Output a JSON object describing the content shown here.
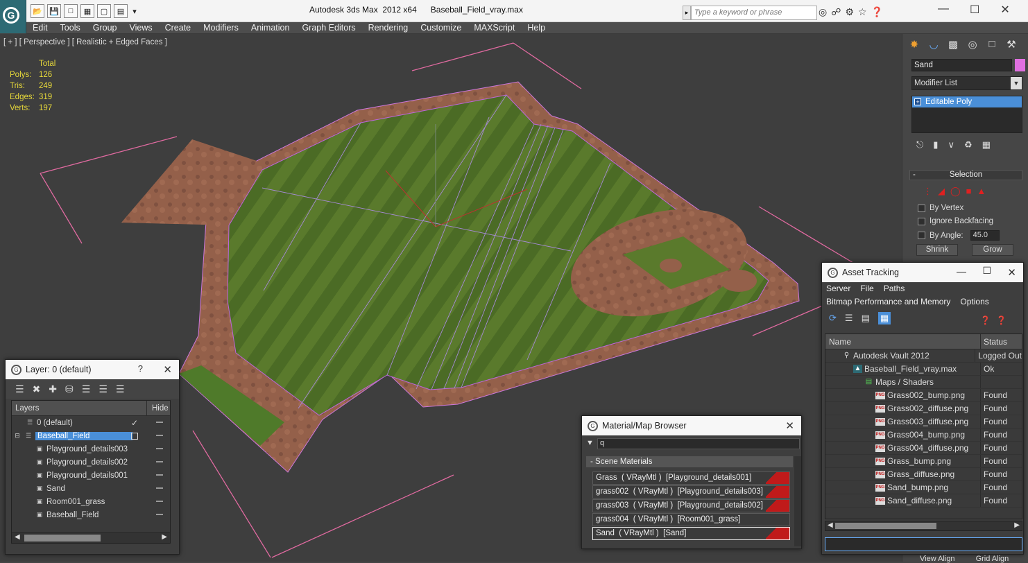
{
  "window": {
    "app_title": "Autodesk 3ds Max  2012 x64",
    "file_title": "Baseball_Field_vray.max",
    "search_placeholder": "Type a keyword or phrase"
  },
  "menu": [
    "Edit",
    "Tools",
    "Group",
    "Views",
    "Create",
    "Modifiers",
    "Animation",
    "Graph Editors",
    "Rendering",
    "Customize",
    "MAXScript",
    "Help"
  ],
  "viewport": {
    "label": "[ + ] [ Perspective ] [ Realistic + Edged Faces ]",
    "stats_header": "Total",
    "stats": [
      {
        "key": "Polys:",
        "value": "126"
      },
      {
        "key": "Tris:",
        "value": "249"
      },
      {
        "key": "Edges:",
        "value": "319"
      },
      {
        "key": "Verts:",
        "value": "197"
      }
    ]
  },
  "command_panel": {
    "object_name": "Sand",
    "object_color": "#e070e0",
    "modifier_list": "Modifier List",
    "stack_item": "Editable Poly",
    "selection_title": "Selection",
    "by_vertex": "By Vertex",
    "ignore_backfacing": "Ignore Backfacing",
    "by_angle": "By Angle:",
    "angle_value": "45.0",
    "shrink": "Shrink",
    "grow": "Grow"
  },
  "layer_panel": {
    "title": "Layer: 0 (default)",
    "help": "?",
    "col_layers": "Layers",
    "col_hide": "Hide",
    "rows": [
      {
        "name": "0 (default)",
        "type": "layer",
        "indent": 0
      },
      {
        "name": "Baseball_Field",
        "type": "layer",
        "indent": 0,
        "selected": true
      },
      {
        "name": "Playground_details003",
        "type": "object",
        "indent": 1
      },
      {
        "name": "Playground_details002",
        "type": "object",
        "indent": 1
      },
      {
        "name": "Playground_details001",
        "type": "object",
        "indent": 1
      },
      {
        "name": "Sand",
        "type": "object",
        "indent": 1
      },
      {
        "name": "Room001_grass",
        "type": "object",
        "indent": 1
      },
      {
        "name": "Baseball_Field",
        "type": "object",
        "indent": 1
      }
    ]
  },
  "material_browser": {
    "title": "Material/Map Browser",
    "search_value": "q",
    "section": "- Scene Materials",
    "rows": [
      "Grass  ( VRayMtl )  [Playground_details001]",
      "grass002  ( VRayMtl )  [Playground_details003]",
      "grass003  ( VRayMtl )  [Playground_details002]",
      "grass004  ( VRayMtl )  [Room001_grass]",
      "Sand  ( VRayMtl )  [Sand]"
    ]
  },
  "asset_tracking": {
    "title": "Asset Tracking",
    "menu1": [
      "Server",
      "File",
      "Paths"
    ],
    "menu2": [
      "Bitmap Performance and Memory",
      "Options"
    ],
    "col_name": "Name",
    "col_status": "Status",
    "rows": [
      {
        "name": "Autodesk Vault 2012",
        "status": "Logged Out",
        "icon": "vault",
        "indent": 1
      },
      {
        "name": "Baseball_Field_vray.max",
        "status": "Ok",
        "icon": "max",
        "indent": 2
      },
      {
        "name": "Maps / Shaders",
        "status": "",
        "icon": "maps",
        "indent": 3
      },
      {
        "name": "Grass002_bump.png",
        "status": "Found",
        "icon": "png",
        "indent": 4
      },
      {
        "name": "Grass002_diffuse.png",
        "status": "Found",
        "icon": "png",
        "indent": 4
      },
      {
        "name": "Grass003_diffuse.png",
        "status": "Found",
        "icon": "png",
        "indent": 4
      },
      {
        "name": "Grass004_bump.png",
        "status": "Found",
        "icon": "png",
        "indent": 4
      },
      {
        "name": "Grass004_diffuse.png",
        "status": "Found",
        "icon": "png",
        "indent": 4
      },
      {
        "name": "Grass_bump.png",
        "status": "Found",
        "icon": "png",
        "indent": 4
      },
      {
        "name": "Grass_diffuse.png",
        "status": "Found",
        "icon": "png",
        "indent": 4
      },
      {
        "name": "Sand_bump.png",
        "status": "Found",
        "icon": "png",
        "indent": 4
      },
      {
        "name": "Sand_diffuse.png",
        "status": "Found",
        "icon": "png",
        "indent": 4
      }
    ]
  },
  "bottom": {
    "view_align": "View Align",
    "grid_align": "Grid Align"
  }
}
